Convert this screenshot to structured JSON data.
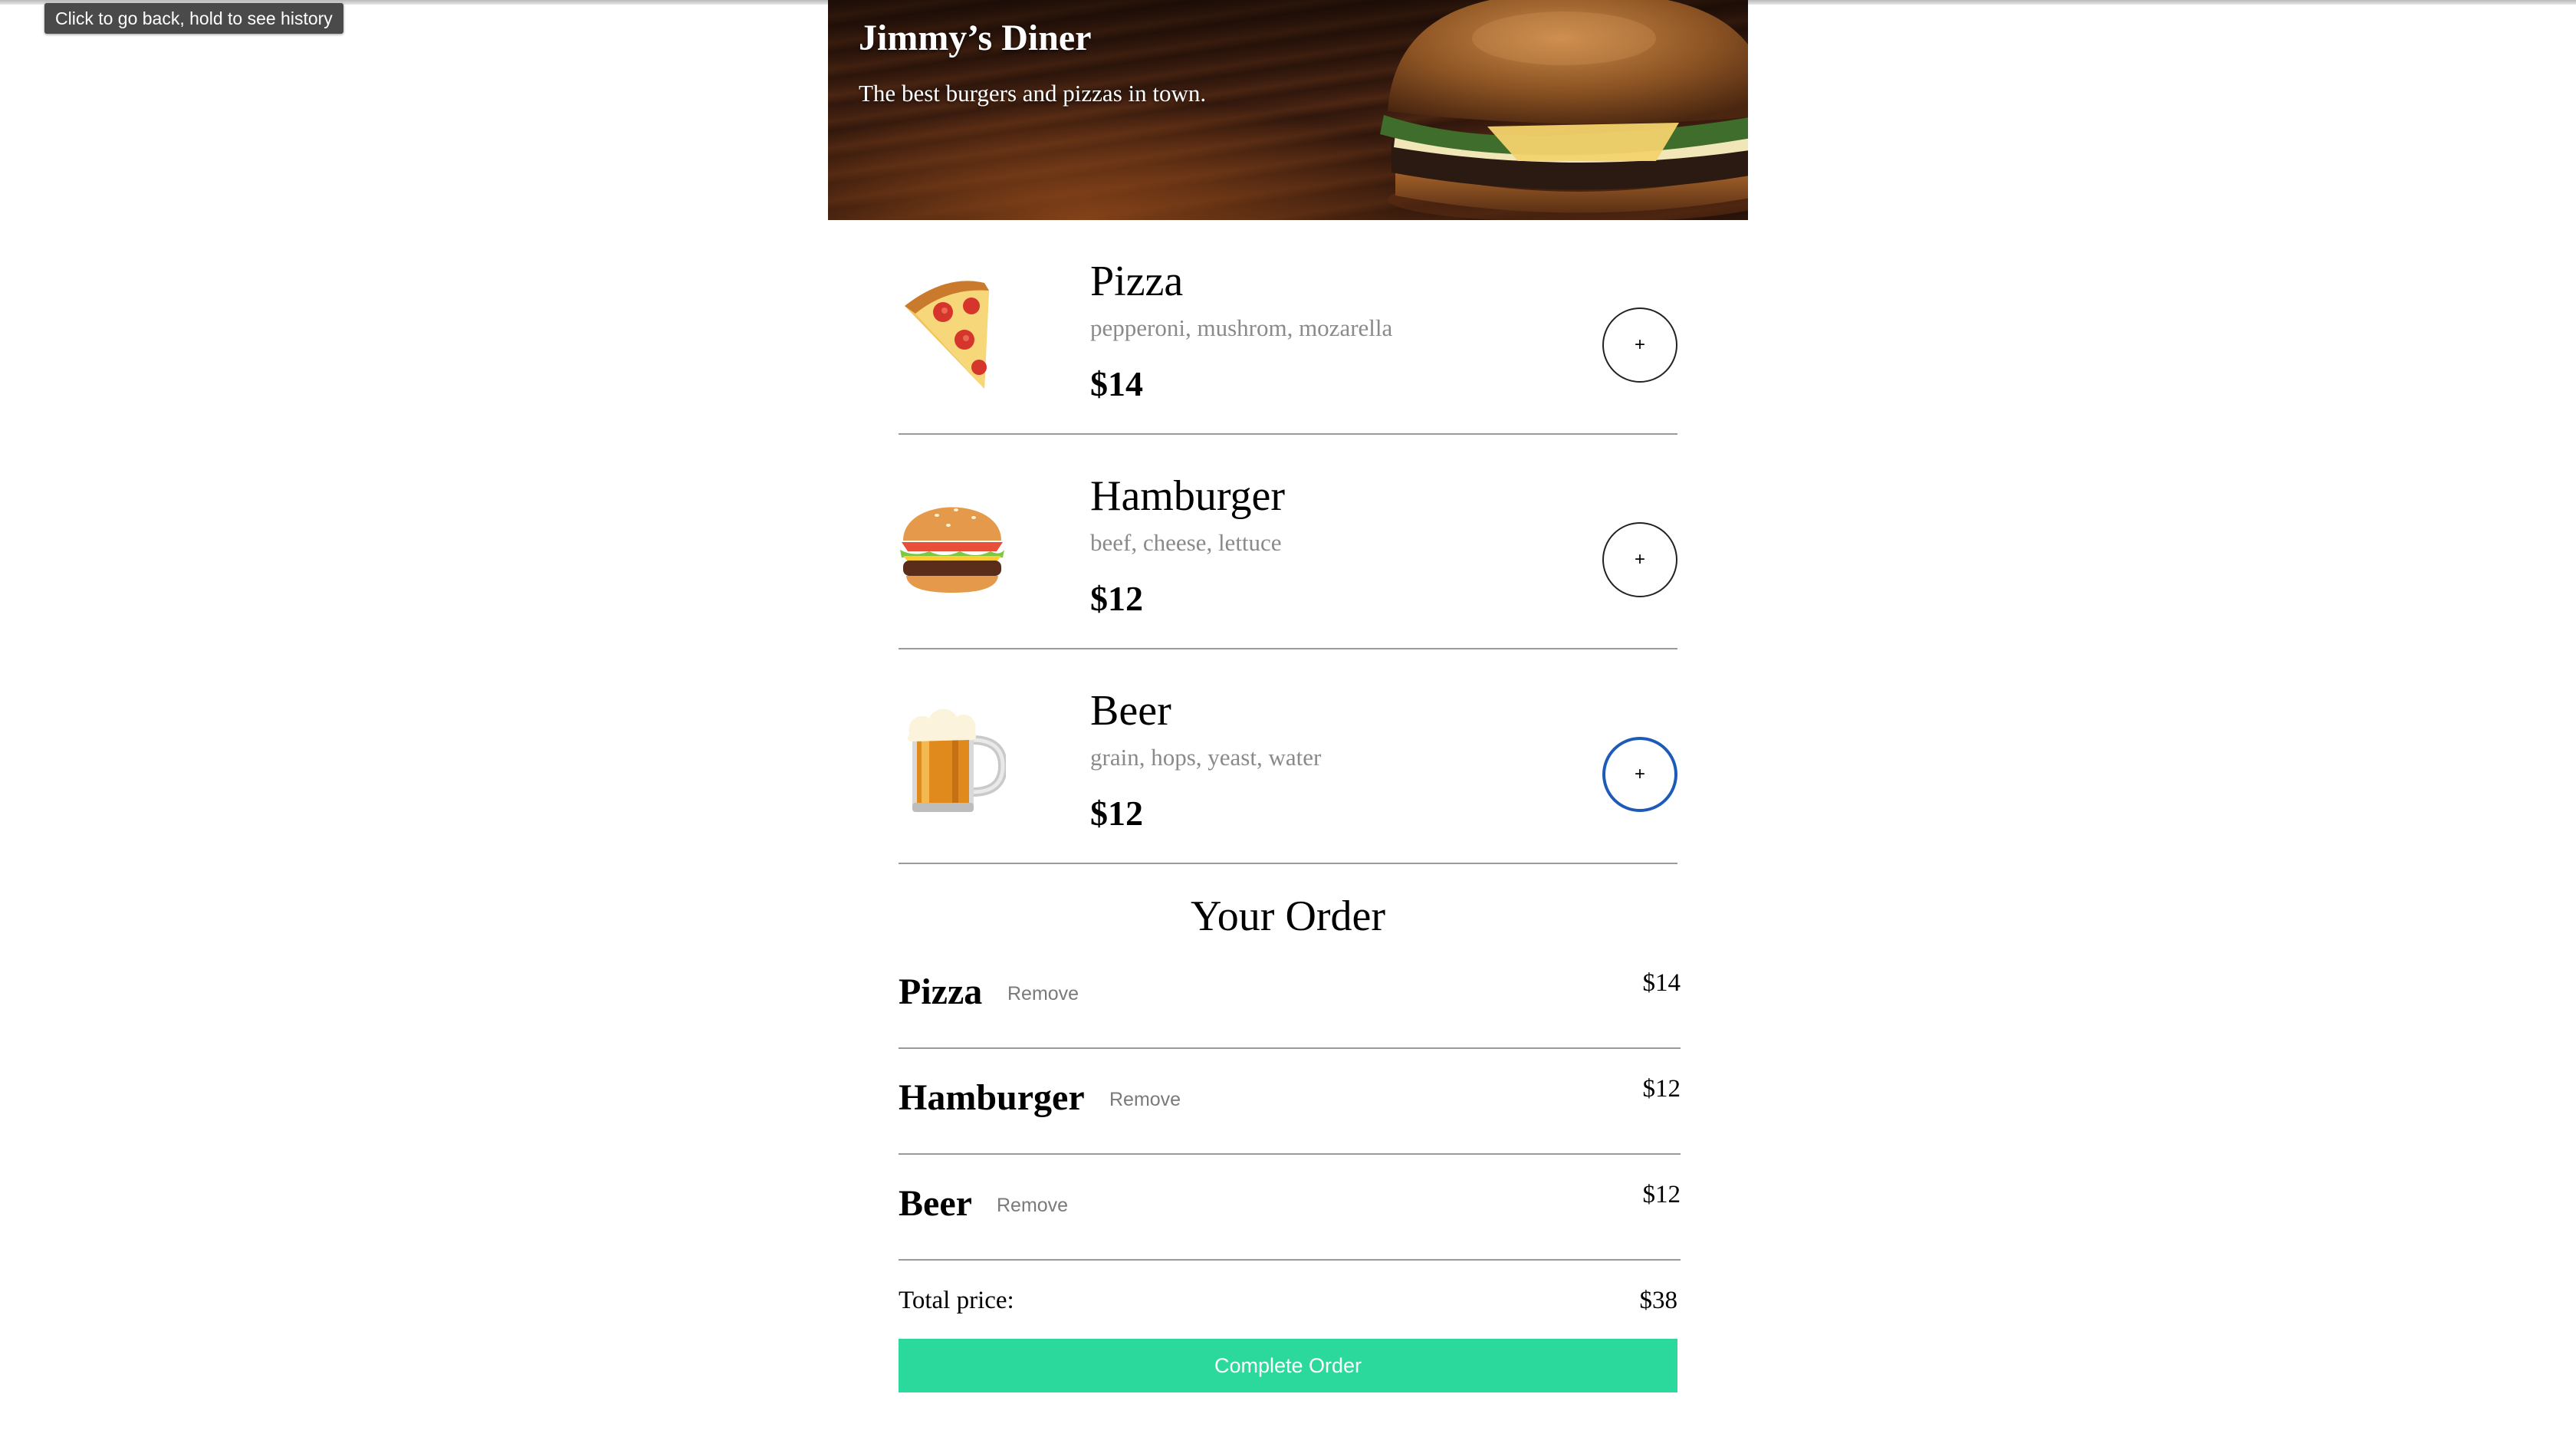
{
  "browser": {
    "back_tooltip": "Click to go back, hold to see history"
  },
  "header": {
    "title": "Jimmy’s Diner",
    "subtitle": "The best burgers and pizzas in town."
  },
  "menu": {
    "items": [
      {
        "name": "Pizza",
        "ingredients": "pepperoni, mushrom, mozarella",
        "price": "$14",
        "add_label": "+",
        "icon": "pizza-icon"
      },
      {
        "name": "Hamburger",
        "ingredients": "beef, cheese, lettuce",
        "price": "$12",
        "add_label": "+",
        "icon": "hamburger-icon"
      },
      {
        "name": "Beer",
        "ingredients": "grain, hops, yeast, water",
        "price": "$12",
        "add_label": "+",
        "icon": "beer-icon"
      }
    ]
  },
  "order": {
    "title": "Your Order",
    "rows": [
      {
        "name": "Pizza",
        "remove_label": "Remove",
        "price": "$14"
      },
      {
        "name": "Hamburger",
        "remove_label": "Remove",
        "price": "$12"
      },
      {
        "name": "Beer",
        "remove_label": "Remove",
        "price": "$12"
      }
    ],
    "total_label": "Total price:",
    "total_value": "$38",
    "complete_label": "Complete Order"
  },
  "colors": {
    "accent_button": "#2bd99c",
    "focus_ring": "#1e5bb8",
    "muted_text": "#8a8a8a"
  }
}
